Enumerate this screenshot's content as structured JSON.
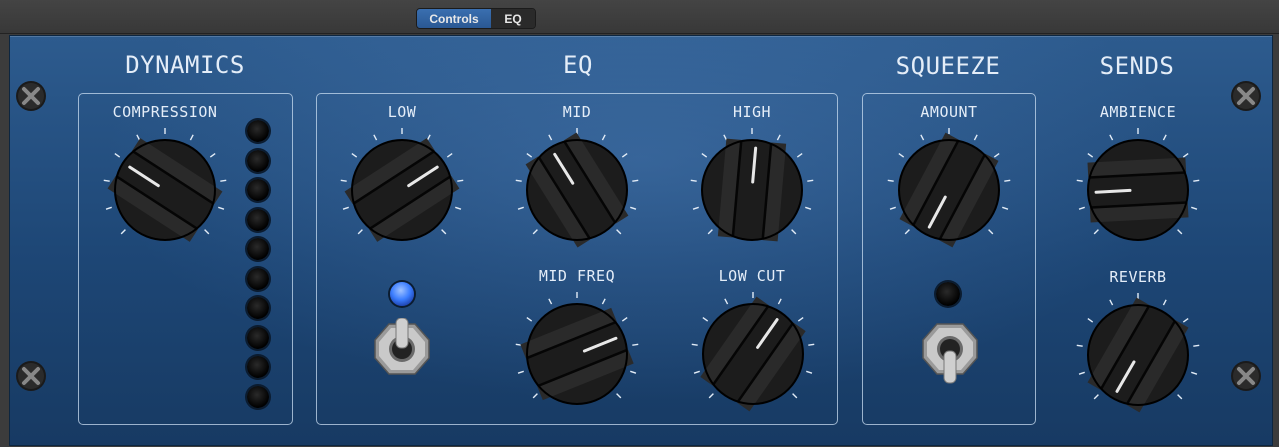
{
  "tabs": [
    {
      "label": "Controls",
      "active": true
    },
    {
      "label": "EQ",
      "active": false
    }
  ],
  "sections": {
    "dynamics": {
      "title": "DYNAMICS",
      "compression_label": "COMPRESSION"
    },
    "eq": {
      "title": "EQ",
      "low_label": "LOW",
      "mid_label": "MID",
      "high_label": "HIGH",
      "mid_freq_label": "MID FREQ",
      "low_cut_label": "LOW CUT"
    },
    "squeeze": {
      "title": "SQUEEZE",
      "amount_label": "AMOUNT"
    },
    "sends": {
      "title": "SENDS",
      "ambience_label": "AMBIENCE",
      "reverb_label": "REVERB"
    }
  },
  "knob_angles_deg": {
    "compression": -57,
    "low": 57,
    "mid": -32,
    "high": 5,
    "mid_freq": 68,
    "low_cut": 35,
    "amount": -152,
    "ambience": -93,
    "reverb": -150
  },
  "eq_enabled": true,
  "squeeze_enabled": false,
  "colors": {
    "panel": "#24507f",
    "accent_tab": "#2f63a3",
    "led_on": "#3b7dff",
    "led_off": "#0a0a0a"
  }
}
